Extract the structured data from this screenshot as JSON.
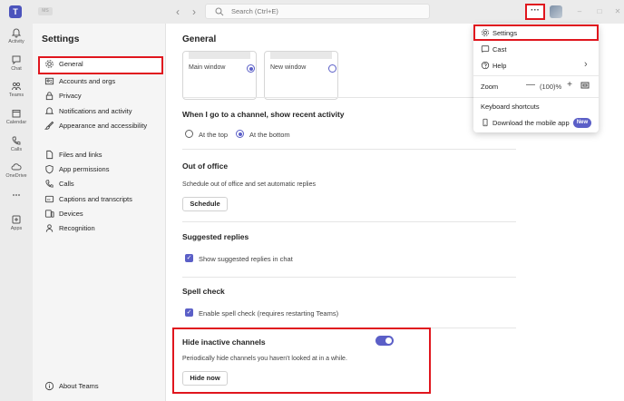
{
  "titlebar": {
    "app_logo": "T",
    "profile_chip": "MS",
    "search_placeholder": "Search (Ctrl+E)",
    "more_label": "···",
    "window_controls": [
      "–",
      "□",
      "✕"
    ]
  },
  "rail": {
    "items": [
      {
        "label": "Activity",
        "icon": "bell-icon"
      },
      {
        "label": "Chat",
        "icon": "chat-icon"
      },
      {
        "label": "Teams",
        "icon": "teams-icon"
      },
      {
        "label": "Calendar",
        "icon": "calendar-icon"
      },
      {
        "label": "Calls",
        "icon": "phone-icon"
      },
      {
        "label": "OneDrive",
        "icon": "cloud-icon"
      },
      {
        "label": "",
        "icon": "more-icon"
      },
      {
        "label": "Apps",
        "icon": "apps-icon"
      }
    ]
  },
  "settings_panel": {
    "title": "Settings",
    "items": [
      {
        "label": "General",
        "icon": "gear-icon",
        "active": true
      },
      {
        "label": "Accounts and orgs",
        "icon": "accounts-icon"
      },
      {
        "label": "Privacy",
        "icon": "lock-icon"
      },
      {
        "label": "Notifications and activity",
        "icon": "bell-icon"
      },
      {
        "label": "Appearance and accessibility",
        "icon": "paintbrush-icon"
      },
      {
        "label": "Files and links",
        "icon": "file-icon"
      },
      {
        "label": "App permissions",
        "icon": "shield-icon"
      },
      {
        "label": "Calls",
        "icon": "phone-icon"
      },
      {
        "label": "Captions and transcripts",
        "icon": "captions-icon"
      },
      {
        "label": "Devices",
        "icon": "devices-icon"
      },
      {
        "label": "Recognition",
        "icon": "recognition-icon"
      }
    ],
    "about_label": "About Teams"
  },
  "main": {
    "title": "General",
    "window_options": [
      {
        "label": "Main window",
        "selected": true
      },
      {
        "label": "New window",
        "selected": false
      }
    ],
    "channel_section": {
      "title": "When I go to a channel, show recent activity",
      "options": [
        {
          "label": "At the top",
          "selected": false
        },
        {
          "label": "At the bottom",
          "selected": true
        }
      ]
    },
    "out_of_office": {
      "title": "Out of office",
      "description": "Schedule out of office and set automatic replies",
      "button": "Schedule"
    },
    "suggested_replies": {
      "title": "Suggested replies",
      "checkbox_label": "Show suggested replies in chat",
      "checked": true
    },
    "spell_check": {
      "title": "Spell check",
      "checkbox_label": "Enable spell check (requires restarting Teams)",
      "checked": true
    },
    "hide_inactive": {
      "title": "Hide inactive channels",
      "description": "Periodically hide channels you haven't looked at in a while.",
      "button": "Hide now",
      "toggle_on": true
    }
  },
  "dropdown": {
    "settings": "Settings",
    "cast": "Cast",
    "help": "Help",
    "zoom_label": "Zoom",
    "zoom_minus": "—",
    "zoom_value": "(100)%",
    "zoom_plus": "+",
    "keyboard_shortcuts": "Keyboard shortcuts",
    "download_mobile": "Download the mobile app",
    "new_badge": "New"
  },
  "colors": {
    "accent": "#5b5fc7",
    "highlight": "#e0161e",
    "brand": "#4b53bc"
  }
}
